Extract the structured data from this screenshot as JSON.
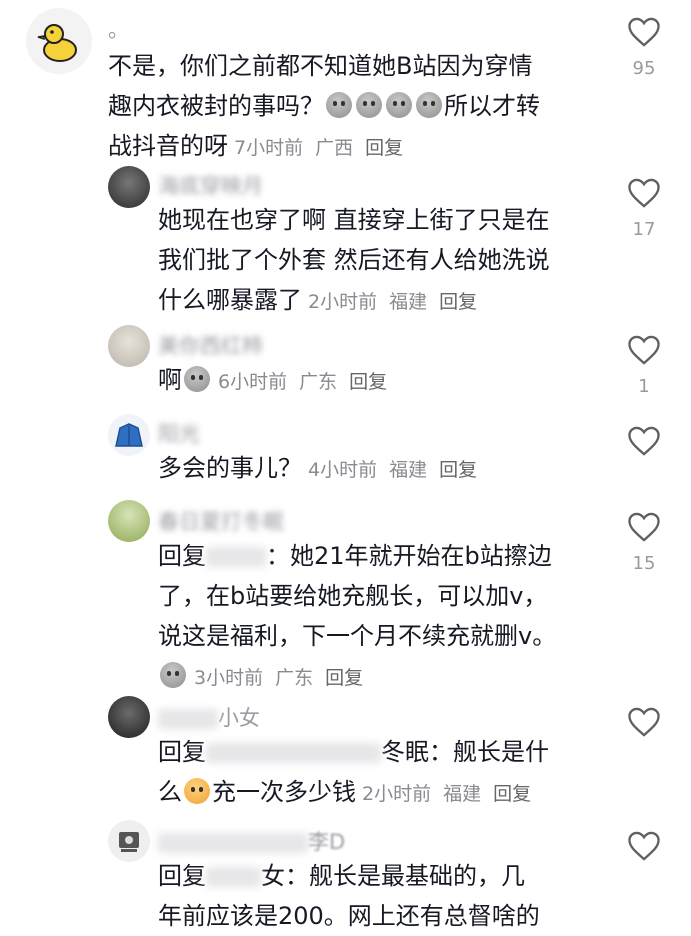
{
  "comments": [
    {
      "id": "c1",
      "name": "。",
      "lines": [
        "不是，你们之前都不知道她B站因为穿情",
        "趣内衣被封的事吗？"
      ],
      "emoji_after_line2": 4,
      "line2_tail": "所以才转",
      "line3": "战抖音的呀",
      "time": "7小时前",
      "location": "广西",
      "reply": "回复",
      "likes": "95"
    },
    {
      "id": "c2",
      "name": "海底穿映月",
      "lines": [
        "她现在也穿了啊 直接穿上街了只是在",
        "我们批了个外套 然后还有人给她洗说",
        "什么哪暴露了"
      ],
      "time": "2小时前",
      "location": "福建",
      "reply": "回复",
      "likes": "17"
    },
    {
      "id": "c3",
      "name": "美你西红柿",
      "text": "啊",
      "time": "6小时前",
      "location": "广东",
      "reply": "回复",
      "likes": "1"
    },
    {
      "id": "c4",
      "name": "阳光",
      "text": "多会的事儿？",
      "time": "4小时前",
      "location": "福建",
      "reply": "回复",
      "likes": ""
    },
    {
      "id": "c5",
      "name": "春日夏打冬眠",
      "prefix": "回复",
      "line1_tail": "：她21年就开始在b站擦边",
      "lines": [
        "了，在b站要给她充舰长，可以加v，",
        "说这是福利，下一个月不续充就删v。"
      ],
      "time": "3小时前",
      "location": "广东",
      "reply": "回复",
      "likes": "15"
    },
    {
      "id": "c6",
      "name": "小女",
      "prefix": "回复",
      "line1_tail": "冬眠：舰长是什",
      "line2_head": "么",
      "line2_tail": "充一次多少钱",
      "time": "2小时前",
      "location": "福建",
      "reply": "回复",
      "likes": ""
    },
    {
      "id": "c7",
      "name": "李D",
      "prefix": "回复",
      "line1_tail": "女：舰长是最基础的，几",
      "line2": "年前应该是200。网上还有总督啥的",
      "likes": ""
    }
  ]
}
